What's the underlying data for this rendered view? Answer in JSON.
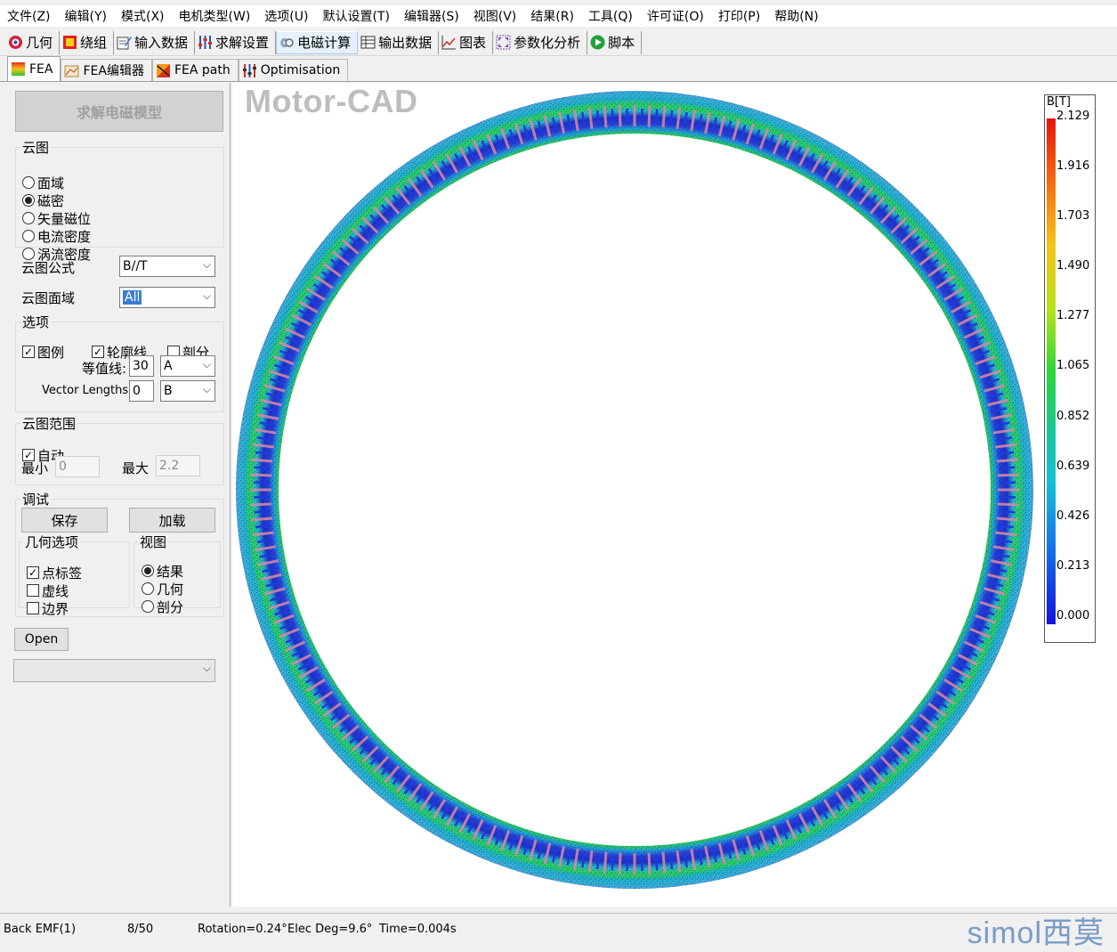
{
  "menu": [
    "文件(Z)",
    "编辑(Y)",
    "模式(X)",
    "电机类型(W)",
    "选项(U)",
    "默认设置(T)",
    "编辑器(S)",
    "视图(V)",
    "结果(R)",
    "工具(Q)",
    "许可证(O)",
    "打印(P)",
    "帮助(N)"
  ],
  "toolbar": {
    "geometry": "几何",
    "winding": "绕组",
    "input_data": "输入数据",
    "solve_settings": "求解设置",
    "em_calc": "电磁计算",
    "output_data": "输出数据",
    "graphs": "图表",
    "parametric": "参数化分析",
    "script": "脚本"
  },
  "subtabs": {
    "fea": "FEA",
    "fea_editor": "FEA编辑器",
    "fea_path": "FEA path",
    "optimisation": "Optimisation"
  },
  "panel": {
    "solve_button": "求解电磁模型",
    "contour_group": "云图",
    "contour_options": [
      "面域",
      "磁密",
      "矢量磁位",
      "电流密度",
      "涡流密度"
    ],
    "contour_selected": "磁密",
    "formula_label": "云图公式",
    "formula_value": "B//T",
    "region_label": "云图面域",
    "region_value": "All",
    "options_group": "选项",
    "legend_label": "图例",
    "outline_label": "轮廓线",
    "mesh_label": "剖分",
    "contour_lines_label": "等值线:",
    "contour_lines_value": "30",
    "contour_lines_unit": "A",
    "vector_lengths_label": "Vector Lengths:",
    "vector_lengths_value": "0",
    "vector_lengths_unit": "B",
    "range_group": "云图范围",
    "auto_label": "自动",
    "min_label": "最小",
    "min_value": "0",
    "max_label": "最大",
    "max_value": "2.2",
    "debug_group": "调试",
    "save_button": "保存",
    "load_button": "加载",
    "geom_options_group": "几何选项",
    "point_labels": "点标签",
    "dashed_lines": "虚线",
    "boundary": "边界",
    "view_group": "视图",
    "view_options": [
      "结果",
      "几何",
      "剖分"
    ],
    "view_selected": "结果",
    "open_button": "Open",
    "bottom_combo_value": ""
  },
  "plot": {
    "watermark": "Motor-CAD",
    "legend_title": "B[T]",
    "legend_ticks": [
      "2.129",
      "1.916",
      "1.703",
      "1.490",
      "1.277",
      "1.065",
      "0.852",
      "0.639",
      "0.426",
      "0.213",
      "0.000"
    ],
    "slot_count": 160
  },
  "status": {
    "mode": "Back EMF(1)",
    "step": "8/50",
    "rotation": "Rotation=0.24°",
    "elec_deg": "Elec Deg=9.6°",
    "time": "Time=0.004s",
    "brand": "simol西莫"
  },
  "colors": {
    "ring_outer": "#3fb2d6",
    "ring_green": "#2ecf4a",
    "ring_blue": "#1f3ad8",
    "slot_pink": "#d98aa5"
  }
}
